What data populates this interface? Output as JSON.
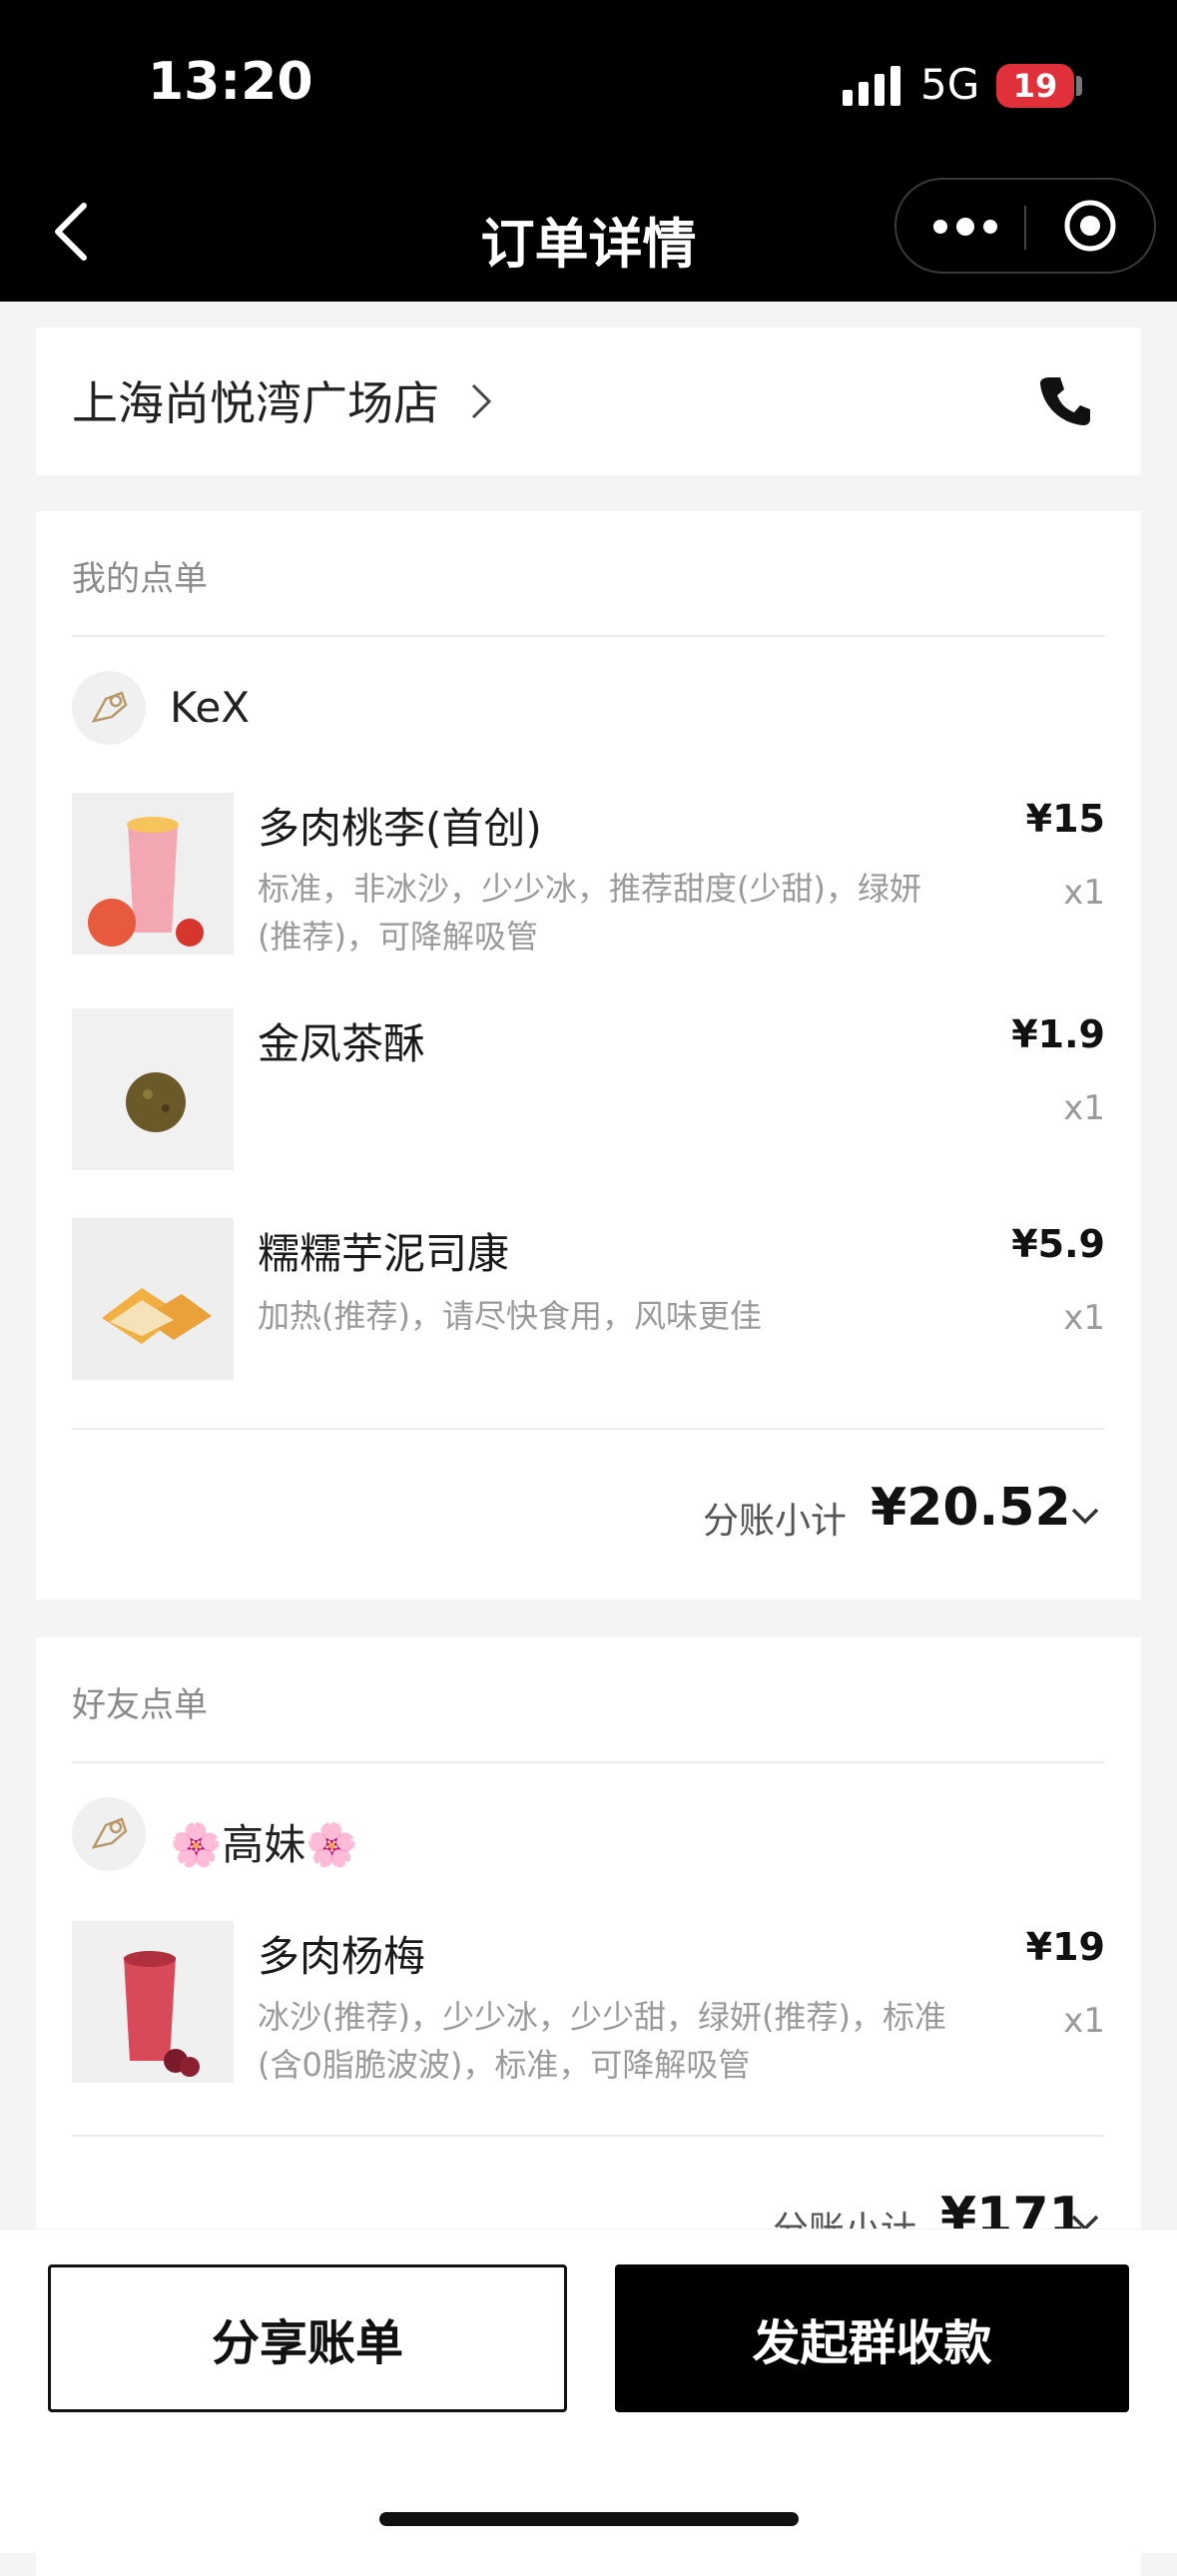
{
  "status": {
    "time": "13:20",
    "network": "5G",
    "battery": "19"
  },
  "nav": {
    "title": "订单详情"
  },
  "store": {
    "name": "上海尚悦湾广场店"
  },
  "my_order": {
    "section_title": "我的点单",
    "user": "KeX",
    "items": [
      {
        "name": "多肉桃李(首创)",
        "options": "标准，非冰沙，少少冰，推荐甜度(少甜)，绿妍(推荐)，可降解吸管",
        "price": "¥15",
        "qty": "x1",
        "image": "peach-drink"
      },
      {
        "name": "金凤茶酥",
        "options": "",
        "price": "¥1.9",
        "qty": "x1",
        "image": "tea-cookie"
      },
      {
        "name": "糯糯芋泥司康",
        "options": "加热(推荐)，请尽快食用，风味更佳",
        "price": "¥5.9",
        "qty": "x1",
        "image": "taro-scone"
      }
    ],
    "subtotal_label": "分账小计",
    "subtotal": "¥20.52"
  },
  "friend_order": {
    "section_title": "好友点单",
    "user": "🌸高妹🌸",
    "items": [
      {
        "name": "多肉杨梅",
        "options": "冰沙(推荐)，少少冰，少少甜，绿妍(推荐)，标准(含0脂脆波波)，标准，可降解吸管",
        "price": "¥19",
        "qty": "x1",
        "image": "bayberry-drink"
      }
    ],
    "subtotal_label": "分账小计",
    "subtotal": "¥171"
  },
  "actions": {
    "share": "分享账单",
    "collect": "发起群收款"
  },
  "colors": {
    "accent": "#000000",
    "battery": "#e0303a"
  }
}
